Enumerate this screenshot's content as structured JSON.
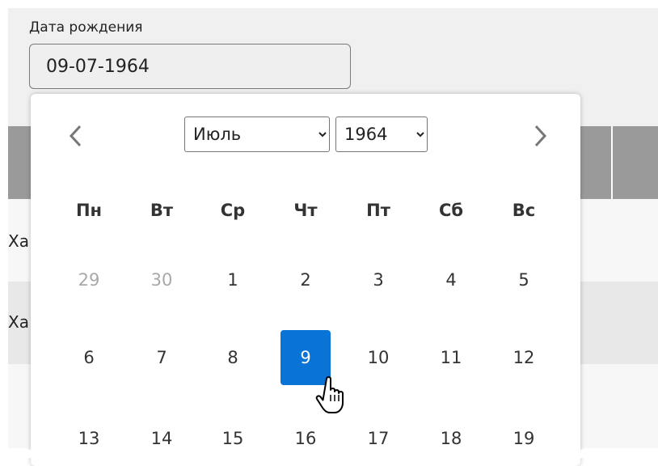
{
  "field": {
    "label": "Дата рождения",
    "value": "09-07-1964"
  },
  "table": {
    "row1_text": "Xa",
    "row2_text": "Xa"
  },
  "calendar": {
    "month": "Июль",
    "year": "1964",
    "weekdays": [
      "Пн",
      "Вт",
      "Ср",
      "Чт",
      "Пт",
      "Сб",
      "Вс"
    ],
    "weeks": [
      [
        {
          "d": "29",
          "other": true
        },
        {
          "d": "30",
          "other": true
        },
        {
          "d": "1"
        },
        {
          "d": "2"
        },
        {
          "d": "3"
        },
        {
          "d": "4"
        },
        {
          "d": "5"
        }
      ],
      [
        {
          "d": "6"
        },
        {
          "d": "7"
        },
        {
          "d": "8"
        },
        {
          "d": "9",
          "selected": true
        },
        {
          "d": "10"
        },
        {
          "d": "11"
        },
        {
          "d": "12"
        }
      ],
      [
        {
          "d": "13"
        },
        {
          "d": "14"
        },
        {
          "d": "15"
        },
        {
          "d": "16"
        },
        {
          "d": "17"
        },
        {
          "d": "18"
        },
        {
          "d": "19"
        }
      ]
    ],
    "selected_color": "#0a74d6",
    "prev_icon": "chevron-left-icon",
    "next_icon": "chevron-right-icon"
  }
}
